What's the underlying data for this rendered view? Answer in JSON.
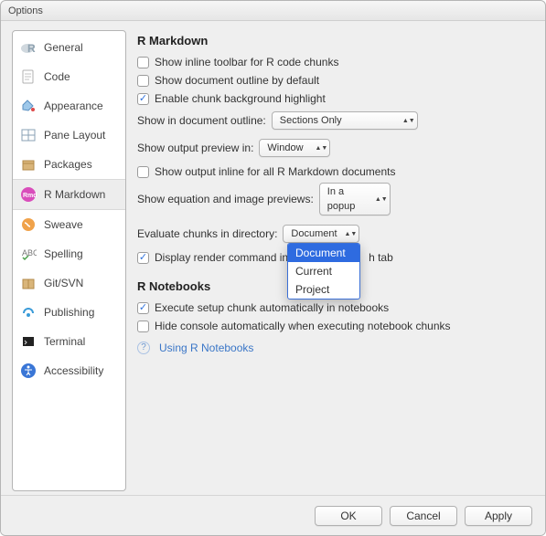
{
  "window": {
    "title": "Options"
  },
  "sidebar": {
    "items": [
      {
        "label": "General"
      },
      {
        "label": "Code"
      },
      {
        "label": "Appearance"
      },
      {
        "label": "Pane Layout"
      },
      {
        "label": "Packages"
      },
      {
        "label": "R Markdown"
      },
      {
        "label": "Sweave"
      },
      {
        "label": "Spelling"
      },
      {
        "label": "Git/SVN"
      },
      {
        "label": "Publishing"
      },
      {
        "label": "Terminal"
      },
      {
        "label": "Accessibility"
      }
    ]
  },
  "panel": {
    "heading1": "R Markdown",
    "opt_inline_toolbar": "Show inline toolbar for R code chunks",
    "opt_document_outline": "Show document outline by default",
    "opt_chunk_bg": "Enable chunk background highlight",
    "label_show_outline": "Show in document outline:",
    "select_show_outline": "Sections Only",
    "label_output_preview": "Show output preview in:",
    "select_output_preview": "Window",
    "opt_output_inline": "Show output inline for all R Markdown documents",
    "label_eq_img": "Show equation and image previews:",
    "select_eq_img": "In a popup",
    "label_eval_dir": "Evaluate chunks in directory:",
    "select_eval_dir": "Document",
    "dropdown_options": [
      "Document",
      "Current",
      "Project"
    ],
    "opt_display_render_pre": "Display render command in",
    "opt_display_render_post": "h tab",
    "heading2": "R Notebooks",
    "opt_exec_setup": "Execute setup chunk automatically in notebooks",
    "opt_hide_console": "Hide console automatically when executing notebook chunks",
    "link_notebooks": "Using R Notebooks"
  },
  "footer": {
    "ok": "OK",
    "cancel": "Cancel",
    "apply": "Apply"
  }
}
